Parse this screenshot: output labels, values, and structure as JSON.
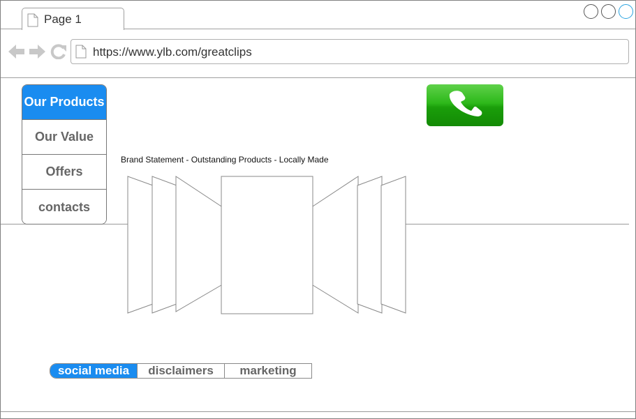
{
  "browser": {
    "tab_title": "Page 1",
    "url": "https://www.ylb.com/greatclips"
  },
  "sidebar": {
    "items": [
      {
        "label": "Our Products",
        "active": true
      },
      {
        "label": "Our Value",
        "active": false
      },
      {
        "label": "Offers",
        "active": false
      },
      {
        "label": "contacts",
        "active": false
      }
    ]
  },
  "main": {
    "brand_statement": "Brand Statement - Outstanding Products - Locally Made"
  },
  "footer": {
    "tabs": [
      {
        "label": "social media",
        "active": true
      },
      {
        "label": "disclaimers",
        "active": false
      },
      {
        "label": "marketing",
        "active": false
      }
    ]
  },
  "colors": {
    "accent": "#1a8cf0",
    "call_button": "#2db81a"
  },
  "icons": {
    "back": "arrow-left-icon",
    "forward": "arrow-right-icon",
    "reload": "reload-icon",
    "page": "document-icon",
    "call": "phone-icon"
  }
}
